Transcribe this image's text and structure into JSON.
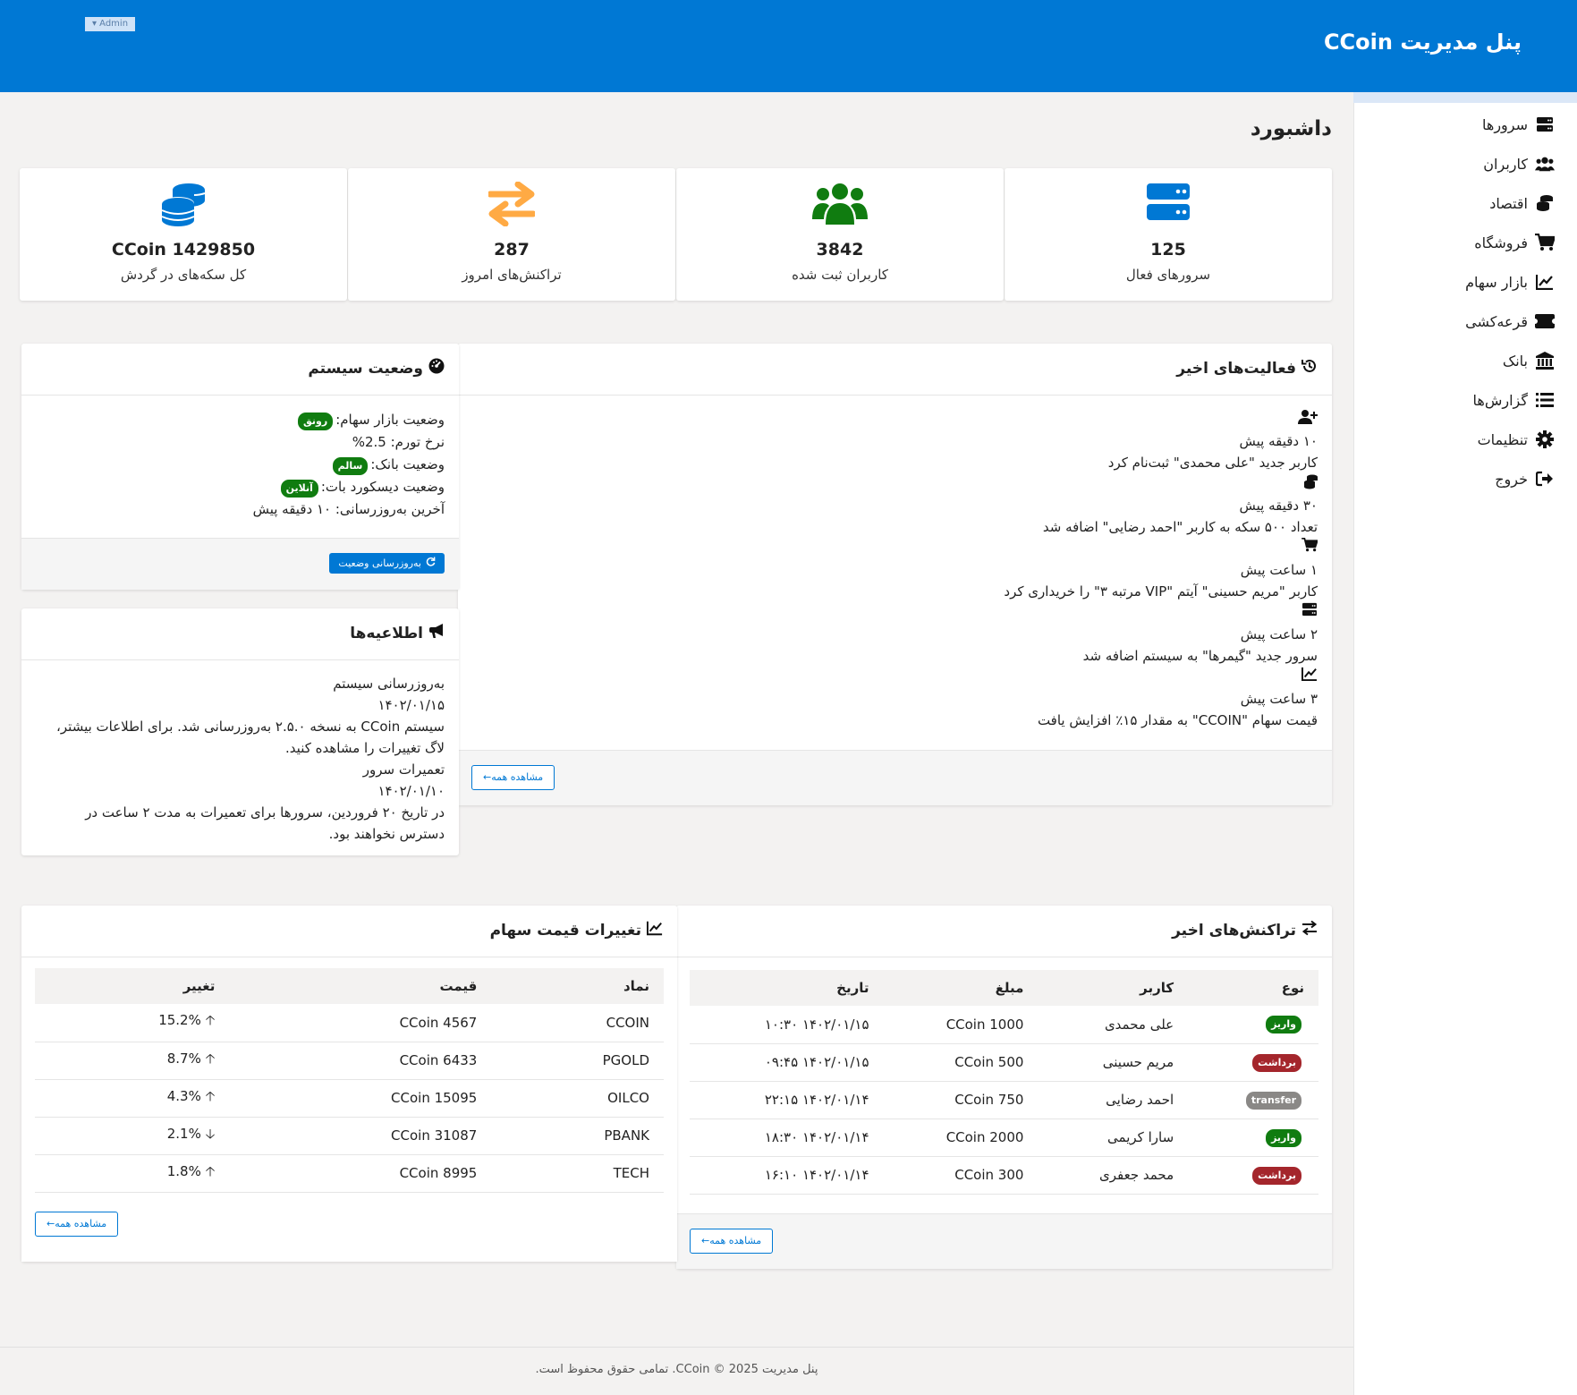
{
  "header": {
    "brand": "پنل مدیریت CCoin",
    "top_left_badge": "Admin ▾"
  },
  "sidebar": {
    "items": [
      {
        "label": "سرورها",
        "icon": "server-icon"
      },
      {
        "label": "کاربران",
        "icon": "users-icon"
      },
      {
        "label": "اقتصاد",
        "icon": "coins-icon"
      },
      {
        "label": "فروشگاه",
        "icon": "cart-icon"
      },
      {
        "label": "بازار سهام",
        "icon": "chart-line-icon"
      },
      {
        "label": "قرعه‌کشی",
        "icon": "ticket-icon"
      },
      {
        "label": "بانک",
        "icon": "bank-icon"
      },
      {
        "label": "گزارش‌ها",
        "icon": "list-icon"
      },
      {
        "label": "تنظیمات",
        "icon": "gear-icon"
      },
      {
        "label": "خروج",
        "icon": "sign-out-icon"
      }
    ]
  },
  "page": {
    "title": "داشبورد"
  },
  "stats": [
    {
      "value": "125",
      "label": "سرورهای فعال",
      "color": "#0078d4"
    },
    {
      "value": "3842",
      "label": "کاربران ثبت شده",
      "color": "#107c10"
    },
    {
      "value": "287",
      "label": "تراکنش‌های امروز",
      "color": "#ffaa44"
    },
    {
      "value": "CCoin 1429850",
      "label": "کل سکه‌های در گردش",
      "color": "#0078d4"
    }
  ],
  "activities": {
    "title": "فعالیت‌های اخیر",
    "items": [
      {
        "icon": "user-plus-icon",
        "time": "۱۰ دقیقه پیش",
        "text": "کاربر جدید \"علی محمدی\" ثبت‌نام کرد"
      },
      {
        "icon": "coins-icon",
        "time": "۳۰ دقیقه پیش",
        "text": "تعداد ۵۰۰ سکه به کاربر \"احمد رضایی\" اضافه شد"
      },
      {
        "icon": "cart-icon",
        "time": "۱ ساعت پیش",
        "text": "کاربر \"مریم حسینی\" آیتم \"VIP مرتبه ۳\" را خریداری کرد"
      },
      {
        "icon": "server-icon",
        "time": "۲ ساعت پیش",
        "text": "سرور جدید \"گیمرها\" به سیستم اضافه شد"
      },
      {
        "icon": "chart-line-icon",
        "time": "۳ ساعت پیش",
        "text": "قیمت سهام \"CCOIN\" به مقدار ۱۵٪ افزایش یافت"
      }
    ],
    "view_all": "مشاهده همه←"
  },
  "system": {
    "title": "وضعیت سیستم",
    "stock_label": "وضعیت بازار سهام:",
    "stock_badge": "رونق",
    "inflation": "نرخ تورم: 2.5%",
    "bank_label": "وضعیت بانک:",
    "bank_badge": "سالم",
    "discord_label": "وضعیت دیسکورد بات:",
    "discord_badge": "آنلاین",
    "last_update": "آخرین به‌روزرسانی: ۱۰ دقیقه پیش",
    "refresh_button": "به‌روزرسانی وضعیت"
  },
  "announcements": {
    "title": "اطلاعیه‌ها",
    "items": [
      {
        "title": "به‌روزرسانی سیستم",
        "date": "۱۴۰۲/۰۱/۱۵",
        "body": "سیستم CCoin به نسخه ۲.۵.۰ به‌روزرسانی شد. برای اطلاعات بیشتر، لاگ تغییرات را مشاهده کنید."
      },
      {
        "title": "تعمیرات سرور",
        "date": "۱۴۰۲/۰۱/۱۰",
        "body": "در تاریخ ۲۰ فروردین، سرورها برای تعمیرات به مدت ۲ ساعت در دسترس نخواهند بود."
      }
    ]
  },
  "transactions": {
    "title": "تراکنش‌های اخیر",
    "columns": [
      "نوع",
      "کاربر",
      "مبلغ",
      "تاریخ"
    ],
    "rows": [
      {
        "type": "واریز",
        "type_color": "#107c10",
        "user": "علی محمدی",
        "amount": "CCoin 1000",
        "date": "۱۴۰۲/۰۱/۱۵ ۱۰:۳۰"
      },
      {
        "type": "برداشت",
        "type_color": "#a4262c",
        "user": "مریم حسینی",
        "amount": "CCoin 500",
        "date": "۱۴۰۲/۰۱/۱۵ ۰۹:۴۵"
      },
      {
        "type": "transfer",
        "type_color": "#8a8886",
        "user": "احمد رضایی",
        "amount": "CCoin 750",
        "date": "۱۴۰۲/۰۱/۱۴ ۲۲:۱۵"
      },
      {
        "type": "واریز",
        "type_color": "#107c10",
        "user": "سارا کریمی",
        "amount": "CCoin 2000",
        "date": "۱۴۰۲/۰۱/۱۴ ۱۸:۳۰"
      },
      {
        "type": "برداشت",
        "type_color": "#a4262c",
        "user": "محمد جعفری",
        "amount": "CCoin 300",
        "date": "۱۴۰۲/۰۱/۱۴ ۱۶:۱۰"
      }
    ],
    "view_all": "مشاهده همه←"
  },
  "stocks": {
    "title": "تغییرات قیمت سهام",
    "columns": [
      "نماد",
      "قیمت",
      "تغییر"
    ],
    "rows": [
      {
        "symbol": "CCOIN",
        "price": "CCoin 4567",
        "change": "15.2%",
        "dir": "up"
      },
      {
        "symbol": "PGOLD",
        "price": "CCoin 6433",
        "change": "8.7%",
        "dir": "up"
      },
      {
        "symbol": "OILCO",
        "price": "CCoin 15095",
        "change": "4.3%",
        "dir": "up"
      },
      {
        "symbol": "PBANK",
        "price": "CCoin 31087",
        "change": "2.1%",
        "dir": "down"
      },
      {
        "symbol": "TECH",
        "price": "CCoin 8995",
        "change": "1.8%",
        "dir": "up"
      }
    ],
    "view_all": "مشاهده همه←"
  },
  "footer": {
    "text": "پنل مدیریت CCoin © 2025. تمامی حقوق محفوظ است."
  }
}
